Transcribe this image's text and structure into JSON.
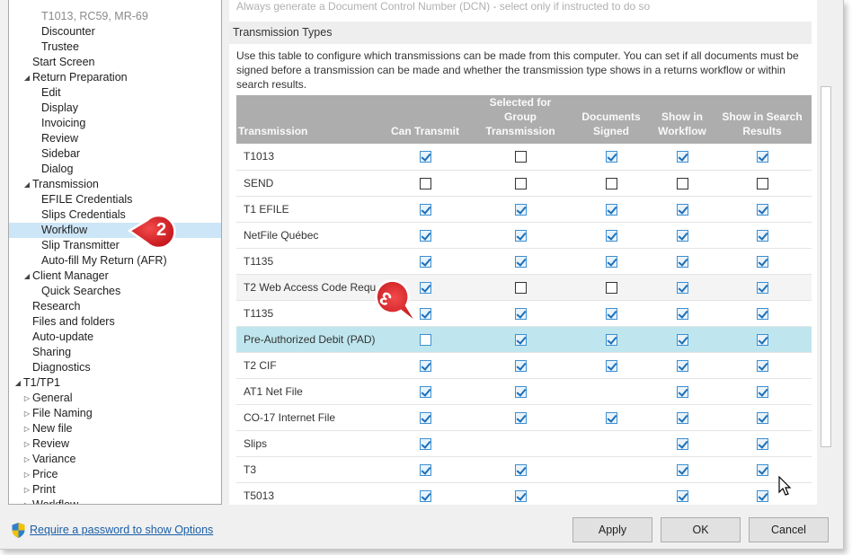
{
  "tree": {
    "items": [
      {
        "label": "T1013, RC59, MR-69",
        "indent": 2,
        "gray": true
      },
      {
        "label": "Discounter",
        "indent": 2
      },
      {
        "label": "Trustee",
        "indent": 2
      },
      {
        "label": "Start Screen",
        "indent": 1
      },
      {
        "label": "Return Preparation",
        "indent": 1,
        "expanded": true
      },
      {
        "label": "Edit",
        "indent": 2
      },
      {
        "label": "Display",
        "indent": 2
      },
      {
        "label": "Invoicing",
        "indent": 2
      },
      {
        "label": "Review",
        "indent": 2
      },
      {
        "label": "Sidebar",
        "indent": 2
      },
      {
        "label": "Dialog",
        "indent": 2
      },
      {
        "label": "Transmission",
        "indent": 1,
        "expanded": true
      },
      {
        "label": "EFILE Credentials",
        "indent": 2
      },
      {
        "label": "Slips Credentials",
        "indent": 2
      },
      {
        "label": "Workflow",
        "indent": 2,
        "selected": true
      },
      {
        "label": "Slip Transmitter",
        "indent": 2
      },
      {
        "label": "Auto-fill My Return (AFR)",
        "indent": 2
      },
      {
        "label": "Client Manager",
        "indent": 1,
        "expanded": true
      },
      {
        "label": "Quick Searches",
        "indent": 2
      },
      {
        "label": "Research",
        "indent": 1
      },
      {
        "label": "Files and folders",
        "indent": 1
      },
      {
        "label": "Auto-update",
        "indent": 1
      },
      {
        "label": "Sharing",
        "indent": 1
      },
      {
        "label": "Diagnostics",
        "indent": 1
      },
      {
        "label": "T1/TP1",
        "indent": 0,
        "expanded": true
      },
      {
        "label": "General",
        "indent": 1,
        "collapsed": true
      },
      {
        "label": "File Naming",
        "indent": 1,
        "collapsed": true
      },
      {
        "label": "New file",
        "indent": 1,
        "collapsed": true
      },
      {
        "label": "Review",
        "indent": 1,
        "collapsed": true
      },
      {
        "label": "Variance",
        "indent": 1,
        "collapsed": true
      },
      {
        "label": "Price",
        "indent": 1,
        "collapsed": true
      },
      {
        "label": "Print",
        "indent": 1,
        "collapsed": true
      },
      {
        "label": "Workflow",
        "indent": 1,
        "collapsed": true
      }
    ]
  },
  "panel": {
    "topline": "Always generate a Document Control Number (DCN) - select only if instructed to do so",
    "section_title": "Transmission Types",
    "description": "Use this table to configure which transmissions can be made from this computer. You can set if all documents must be signed before a transmission can be made and whether the transmission type shows in a returns workflow or within search results.",
    "columns": [
      "Transmission",
      "Can Transmit",
      "Selected for Group Transmission",
      "Documents Signed",
      "Show in Workflow",
      "Show in Search Results"
    ],
    "rows": [
      {
        "name": "T1013",
        "cells": [
          1,
          0,
          1,
          1,
          1
        ]
      },
      {
        "name": "SEND",
        "cells": [
          0,
          0,
          0,
          0,
          0
        ]
      },
      {
        "name": "T1 EFILE",
        "cells": [
          1,
          1,
          1,
          1,
          1
        ]
      },
      {
        "name": "NetFile Québec",
        "cells": [
          1,
          1,
          1,
          1,
          1
        ]
      },
      {
        "name": "T1135",
        "cells": [
          1,
          1,
          1,
          1,
          1
        ]
      },
      {
        "name": "T2 Web Access Code Requ...",
        "cells": [
          1,
          0,
          0,
          1,
          1
        ],
        "gray": true
      },
      {
        "name": "T1135",
        "cells": [
          1,
          1,
          1,
          1,
          1
        ]
      },
      {
        "name": "Pre-Authorized Debit (PAD)",
        "cells": [
          0,
          1,
          1,
          1,
          1
        ],
        "highlight": true
      },
      {
        "name": "T2 CIF",
        "cells": [
          1,
          1,
          1,
          1,
          1
        ]
      },
      {
        "name": "AT1 Net File",
        "cells": [
          1,
          1,
          null,
          1,
          1
        ]
      },
      {
        "name": "CO-17 Internet File",
        "cells": [
          1,
          1,
          1,
          1,
          1
        ]
      },
      {
        "name": "Slips",
        "cells": [
          1,
          null,
          null,
          1,
          1
        ]
      },
      {
        "name": "T3",
        "cells": [
          1,
          1,
          null,
          1,
          1
        ]
      },
      {
        "name": "T5013",
        "cells": [
          1,
          1,
          null,
          1,
          1
        ]
      }
    ]
  },
  "footer": {
    "password_link": "Require a password to show Options",
    "apply": "Apply",
    "ok": "OK",
    "cancel": "Cancel"
  },
  "callouts": {
    "step2": "2",
    "step3": "3"
  },
  "colors": {
    "accent_red": "#e0262c",
    "selection": "#cde6f7",
    "row_highlight": "#bfe6ee",
    "link": "#1a5ea8"
  }
}
